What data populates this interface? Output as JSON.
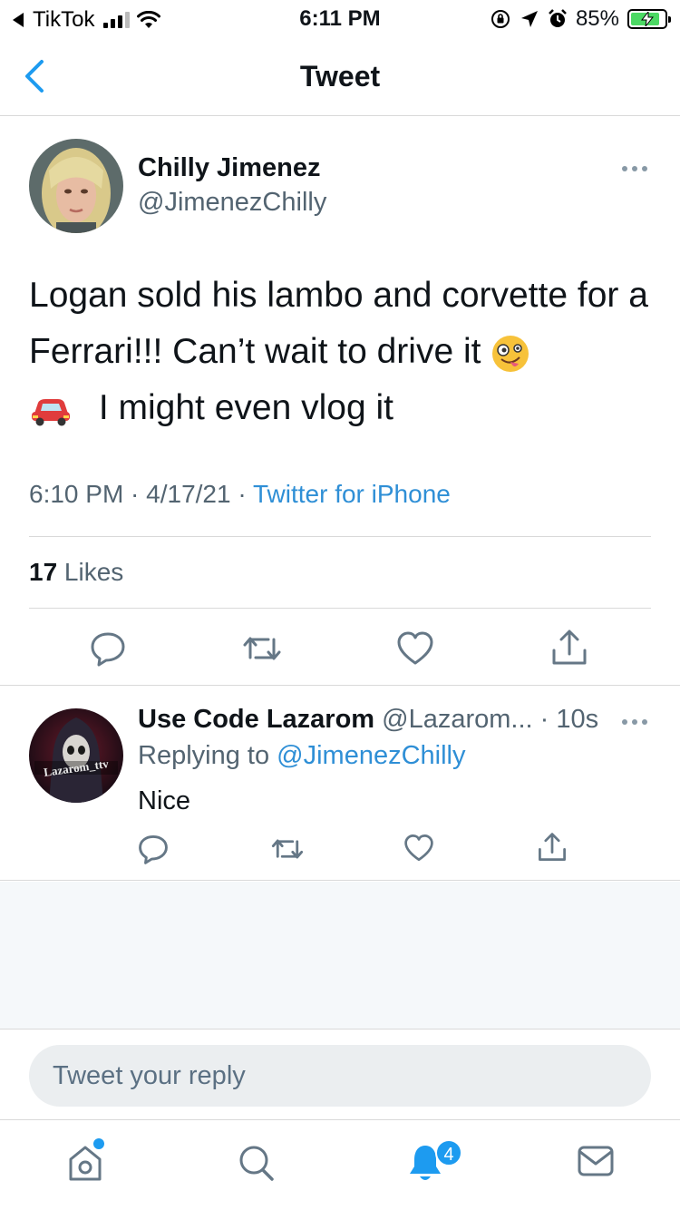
{
  "status_bar": {
    "back_app": "TikTok",
    "time": "6:11 PM",
    "battery": "85%",
    "battery_level": 0.85
  },
  "nav": {
    "title": "Tweet"
  },
  "tweet": {
    "author_name": "Chilly Jimenez",
    "author_handle": "@JimenezChilly",
    "text_part1": "Logan sold his lambo and corvette for a Ferrari!!! Can’t wait to drive it",
    "text_part2": "I might even vlog it",
    "emojis": [
      "zany-face",
      "red-car"
    ],
    "timestamp": "6:10 PM · 4/17/21 · ",
    "source": "Twitter for iPhone",
    "likes_count": "17",
    "likes_label": " Likes"
  },
  "reply": {
    "author_name": "Use Code Lazarom",
    "author_handle": " @Lazarom... · 10s",
    "replying_prefix": "Replying to ",
    "replying_to": "@JimenezChilly",
    "text": "Nice",
    "avatar_text": "Lazarom_ttv"
  },
  "compose": {
    "placeholder": "Tweet your reply"
  },
  "tabbar": {
    "notifications_badge": "4",
    "icons": [
      "home-icon",
      "search-icon",
      "notifications-icon",
      "messages-icon"
    ]
  },
  "colors": {
    "accent": "#1d9bf0",
    "link": "#2f8fd6",
    "secondary_text": "#536471",
    "icon": "#657786",
    "background_gray": "#f5f8fa"
  }
}
